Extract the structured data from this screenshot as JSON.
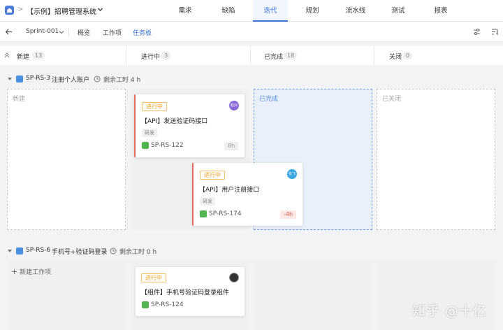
{
  "topbar": {
    "project_title": "【示例】招聘管理系统",
    "tabs": [
      "需求",
      "缺陷",
      "迭代",
      "规划",
      "流水线",
      "测试",
      "报表"
    ],
    "active_tab": "迭代"
  },
  "subbar": {
    "sprint": "Sprint-001",
    "tabs": [
      "概览",
      "工作项",
      "任务板"
    ],
    "active_tab": "任务板"
  },
  "columns": [
    {
      "label": "新建",
      "count": "13"
    },
    {
      "label": "进行中",
      "count": "3"
    },
    {
      "label": "已完成",
      "count": "18"
    },
    {
      "label": "关闭",
      "count": "0"
    }
  ],
  "groups": [
    {
      "id": "SP-RS-3",
      "name": "注册个人账户",
      "remain": "剩余工时 4 h",
      "lane_labels": [
        "新建",
        "已完成",
        "已关闭"
      ],
      "cards": [
        {
          "status": "进行中",
          "avatar": "赵兴",
          "title": "【API】发送验证码接口",
          "tag": "研发",
          "id": "SP-RS-122",
          "hours": "8h"
        },
        {
          "status": "进行中",
          "avatar": "张飞",
          "title": "【API】用户注册接口",
          "tag": "研发",
          "id": "SP-RS-174",
          "hours": "-4h"
        }
      ]
    },
    {
      "id": "SP-RS-6",
      "name": "手机号+验证码登录",
      "remain": "剩余工时 0 h",
      "new_item": "新建工作项",
      "cards": [
        {
          "status": "进行中",
          "title": "【组件】手机号验证码登录组件",
          "id": "SP-RS-124"
        }
      ]
    }
  ],
  "watermark": "知乎 @十亿",
  "colors": {
    "accent": "#3a75d8",
    "in_progress": "#f0a020",
    "done": "#52b552",
    "negative": "#e0584a"
  }
}
